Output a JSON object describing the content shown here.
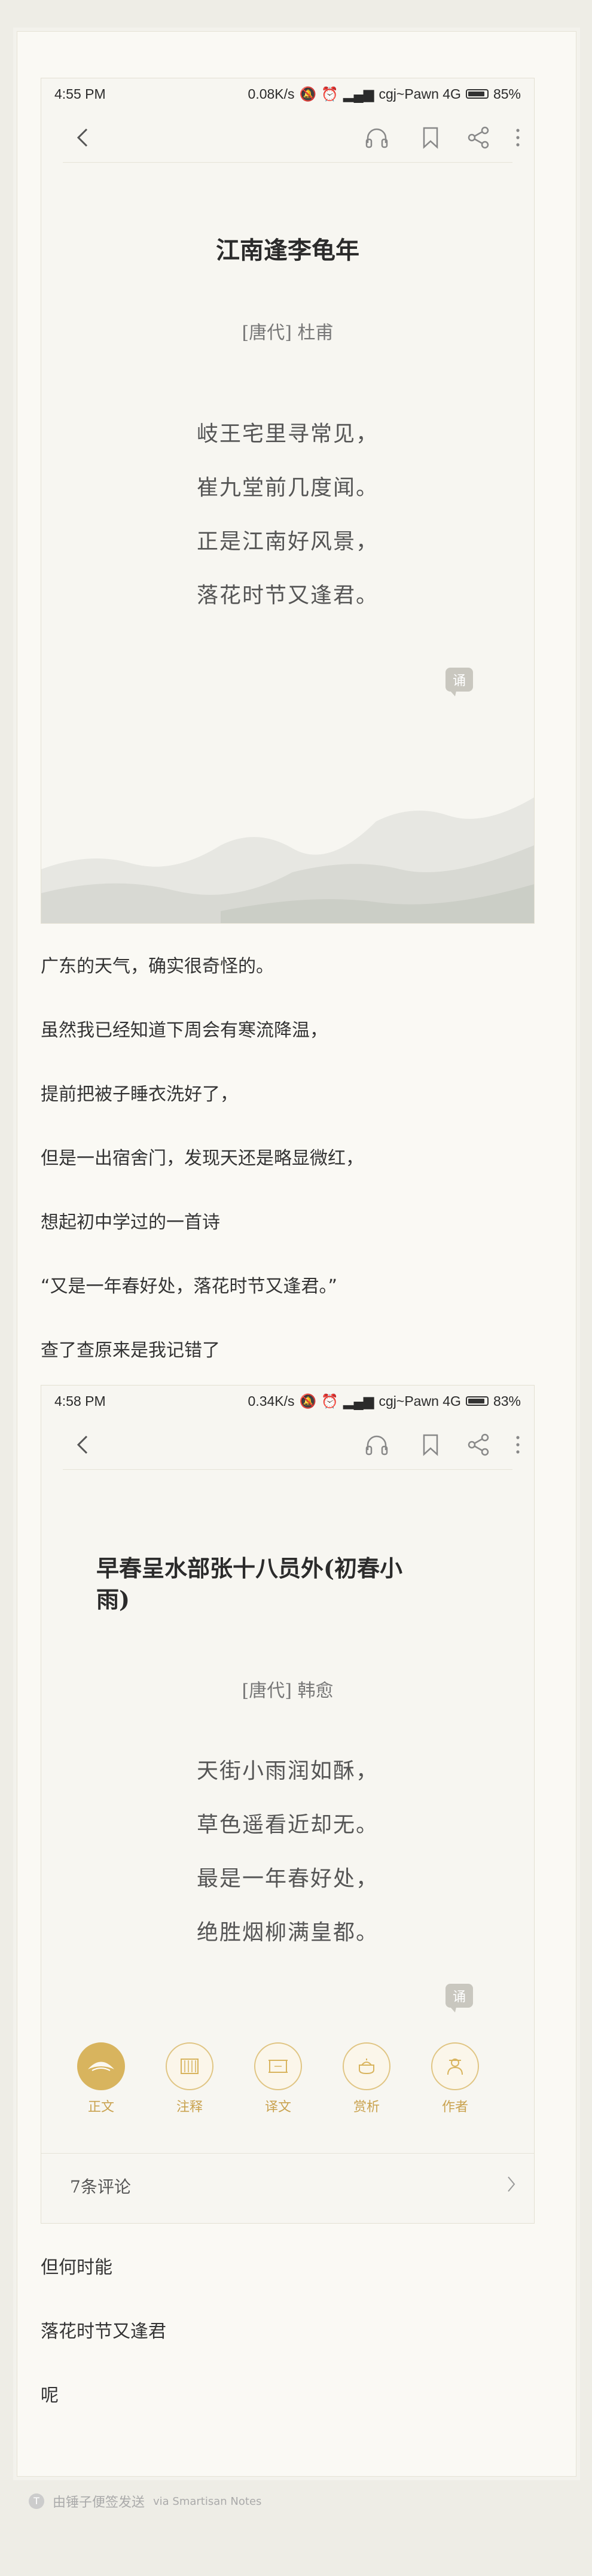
{
  "screenshot1": {
    "status": {
      "time": "4:55 PM",
      "net": "0.08K/s",
      "carrier": "cgj~Pawn 4G",
      "battery": "85%"
    },
    "title": "江南逢李龟年",
    "author": "[唐代]  杜甫",
    "lines": [
      "岐王宅里寻常见，",
      "崔九堂前几度闻。",
      "正是江南好风景，",
      "落花时节又逢君。"
    ],
    "recite": "诵"
  },
  "paragraphs": [
    "广东的天气，确实很奇怪的。",
    "虽然我已经知道下周会有寒流降温，",
    "提前把被子睡衣洗好了，",
    "但是一出宿舍门，发现天还是略显微红，",
    "想起初中学过的一首诗",
    "“又是一年春好处，落花时节又逢君。”",
    "查了查原来是我记错了"
  ],
  "screenshot2": {
    "status": {
      "time": "4:58 PM",
      "net": "0.34K/s",
      "carrier": "cgj~Pawn 4G",
      "battery": "83%"
    },
    "title_line1": "早春呈水部张十八员外(初春小",
    "title_line2": "雨)",
    "author": "[唐代]  韩愈",
    "lines": [
      "天街小雨润如酥，",
      "草色遥看近却无。",
      "最是一年春好处，",
      "绝胜烟柳满皇都。"
    ],
    "recite": "诵",
    "tabs": [
      {
        "label": "正文",
        "icon": "fan-icon"
      },
      {
        "label": "注释",
        "icon": "scroll-icon"
      },
      {
        "label": "译文",
        "icon": "frame-icon"
      },
      {
        "label": "赏析",
        "icon": "teapot-icon"
      },
      {
        "label": "作者",
        "icon": "person-icon"
      }
    ],
    "comments": "7条评论"
  },
  "paragraphs2": [
    "但何时能",
    "落花时节又逢君",
    "呢"
  ],
  "footer": {
    "text": "由锤子便签发送",
    "via": "via Smartisan Notes"
  },
  "colors": {
    "gold": "#d8b45e",
    "paper": "#f7f6f1"
  }
}
